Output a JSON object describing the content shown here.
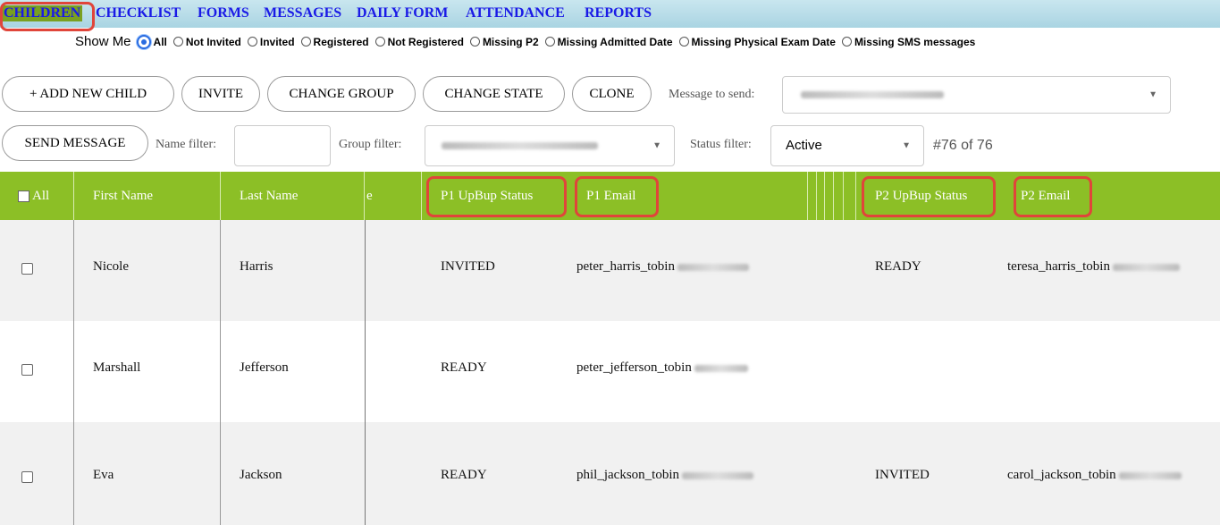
{
  "nav": {
    "items": [
      {
        "label": "CHILDREN",
        "active": true
      },
      {
        "label": "CHECKLIST"
      },
      {
        "label": "FORMS"
      },
      {
        "label": "MESSAGES"
      },
      {
        "label": "DAILY FORM"
      },
      {
        "label": "ATTENDANCE"
      },
      {
        "label": "REPORTS"
      }
    ]
  },
  "show_me": {
    "label": "Show Me",
    "options": [
      "All",
      "Not Invited",
      "Invited",
      "Registered",
      "Not Registered",
      "Missing P2",
      "Missing Admitted Date",
      "Missing Physical Exam Date",
      "Missing SMS messages"
    ],
    "selected": "All"
  },
  "toolbar": {
    "add_child": "+ ADD NEW CHILD",
    "invite": "INVITE",
    "change_group": "CHANGE GROUP",
    "change_state": "CHANGE STATE",
    "clone": "CLONE",
    "message_label": "Message to send:",
    "send_message": "SEND MESSAGE",
    "name_filter_label": "Name filter:",
    "group_filter_label": "Group filter:",
    "status_filter_label": "Status filter:",
    "status_filter_value": "Active",
    "count": "#76 of 76"
  },
  "table": {
    "headers": {
      "all": "All",
      "first_name": "First Name",
      "last_name": "Last Name",
      "partial": "e",
      "p1_status": "P1 UpBup Status",
      "p1_email": "P1 Email",
      "p2_status": "P2 UpBup Status",
      "p2_email": "P2 Email"
    },
    "rows": [
      {
        "first": "Nicole",
        "last": "Harris",
        "p1_status": "INVITED",
        "p1_email": "peter_harris_tobin",
        "p2_status": "READY",
        "p2_email": "teresa_harris_tobin"
      },
      {
        "first": "Marshall",
        "last": "Jefferson",
        "p1_status": "READY",
        "p1_email": "peter_jefferson_tobin",
        "p2_status": "",
        "p2_email": ""
      },
      {
        "first": "Eva",
        "last": "Jackson",
        "p1_status": "READY",
        "p1_email": "phil_jackson_tobin",
        "p2_status": "INVITED",
        "p2_email": "carol_jackson_tobin"
      }
    ]
  },
  "colors": {
    "nav_bg": "#b8dde9",
    "header_green": "#8cbf26",
    "highlight_red": "#e0453a",
    "link_blue": "#1a1ae6"
  }
}
